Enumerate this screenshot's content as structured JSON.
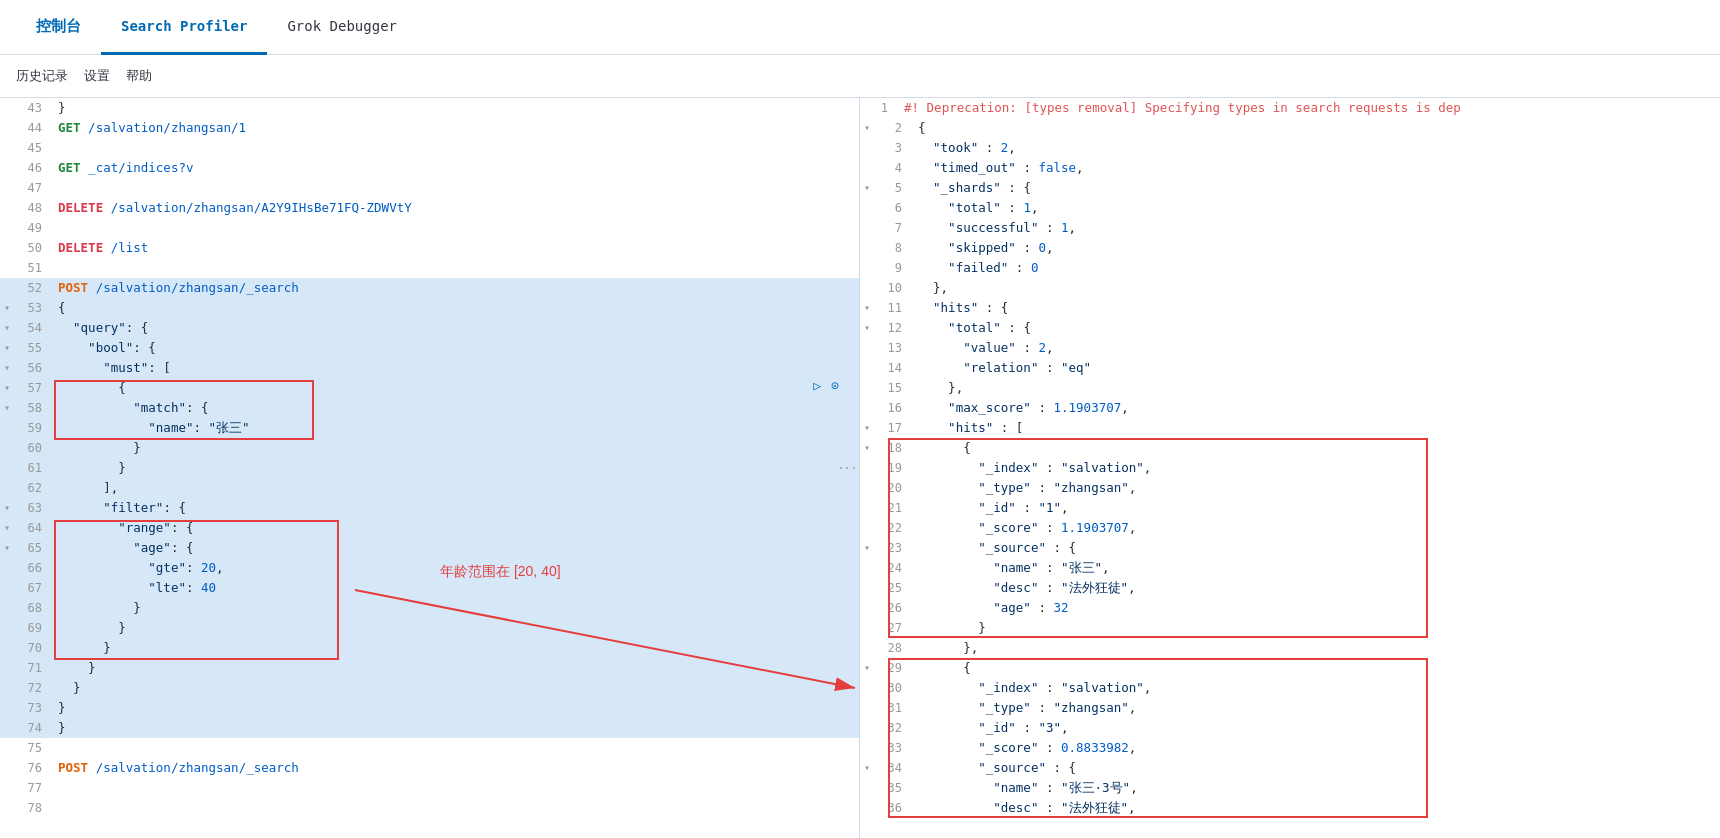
{
  "nav": {
    "items": [
      {
        "label": "控制台",
        "active": false,
        "chinese": true
      },
      {
        "label": "Search Profiler",
        "active": true
      },
      {
        "label": "Grok Debugger",
        "active": false
      }
    ]
  },
  "toolbar": {
    "items": [
      "历史记录",
      "设置",
      "帮助"
    ]
  },
  "editor": {
    "lines": [
      {
        "num": "43",
        "content": "}"
      },
      {
        "num": "44",
        "content": "GET /salvation/zhangsan/1",
        "type": "get"
      },
      {
        "num": "45",
        "content": ""
      },
      {
        "num": "46",
        "content": "GET _cat/indices?v",
        "type": "get"
      },
      {
        "num": "47",
        "content": ""
      },
      {
        "num": "48",
        "content": "DELETE /salvation/zhangsan/A2Y9IHsBe71FQ-ZDWVtY",
        "type": "delete"
      },
      {
        "num": "49",
        "content": ""
      },
      {
        "num": "50",
        "content": "DELETE /list",
        "type": "delete"
      },
      {
        "num": "51",
        "content": ""
      },
      {
        "num": "52",
        "content": "POST /salvation/zhangsan/_search",
        "type": "post",
        "selected": true
      },
      {
        "num": "53",
        "content": "{",
        "selected": true
      },
      {
        "num": "54",
        "content": "  \"query\": {",
        "selected": true
      },
      {
        "num": "55",
        "content": "    \"bool\": {",
        "selected": true
      },
      {
        "num": "56",
        "content": "      \"must\": [",
        "selected": true
      },
      {
        "num": "57",
        "content": "        {",
        "selected": true
      },
      {
        "num": "58",
        "content": "          \"match\": {",
        "selected": true,
        "boxed": "match_open"
      },
      {
        "num": "59",
        "content": "            \"name\": \"张三\"",
        "selected": true,
        "boxed": "match_inner"
      },
      {
        "num": "60",
        "content": "          }",
        "selected": true,
        "boxed": "match_close"
      },
      {
        "num": "61",
        "content": "        }",
        "selected": true
      },
      {
        "num": "62",
        "content": "      ],",
        "selected": true
      },
      {
        "num": "63",
        "content": "      \"filter\": {",
        "selected": true,
        "boxed": "filter_open"
      },
      {
        "num": "64",
        "content": "        \"range\": {",
        "selected": true,
        "boxed": "filter_inner"
      },
      {
        "num": "65",
        "content": "          \"age\": {",
        "selected": true,
        "boxed": "filter_inner"
      },
      {
        "num": "66",
        "content": "            \"gte\": 20,",
        "selected": true,
        "boxed": "filter_inner"
      },
      {
        "num": "67",
        "content": "            \"lte\": 40",
        "selected": true,
        "boxed": "filter_inner"
      },
      {
        "num": "68",
        "content": "          }",
        "selected": true,
        "boxed": "filter_inner"
      },
      {
        "num": "69",
        "content": "        }",
        "selected": true,
        "boxed": "filter_close"
      },
      {
        "num": "70",
        "content": "      }",
        "selected": true
      },
      {
        "num": "71",
        "content": "    }",
        "selected": true
      },
      {
        "num": "72",
        "content": "  }",
        "selected": true
      },
      {
        "num": "73",
        "content": "}",
        "selected": true
      },
      {
        "num": "74",
        "content": "}",
        "selected": true
      },
      {
        "num": "75",
        "content": ""
      },
      {
        "num": "76",
        "content": "POST /salvation/zhangsan/_search",
        "type": "post"
      },
      {
        "num": "77",
        "content": ""
      },
      {
        "num": "78",
        "content": ""
      }
    ]
  },
  "output": {
    "lines": [
      {
        "num": "1",
        "content": "#! Deprecation: [types removal] Specifying types in search requests is dep",
        "type": "comment"
      },
      {
        "num": "2",
        "content": "{"
      },
      {
        "num": "3",
        "content": "  \"took\" : 2,"
      },
      {
        "num": "4",
        "content": "  \"timed_out\" : false,"
      },
      {
        "num": "5",
        "content": "  \"_shards\" : {"
      },
      {
        "num": "6",
        "content": "    \"total\" : 1,"
      },
      {
        "num": "7",
        "content": "    \"successful\" : 1,"
      },
      {
        "num": "8",
        "content": "    \"skipped\" : 0,"
      },
      {
        "num": "9",
        "content": "    \"failed\" : 0"
      },
      {
        "num": "10",
        "content": "  },"
      },
      {
        "num": "11",
        "content": "  \"hits\" : {"
      },
      {
        "num": "12",
        "content": "    \"total\" : {"
      },
      {
        "num": "13",
        "content": "      \"value\" : 2,"
      },
      {
        "num": "14",
        "content": "      \"relation\" : \"eq\""
      },
      {
        "num": "15",
        "content": "    },"
      },
      {
        "num": "16",
        "content": "    \"max_score\" : 1.1903707,"
      },
      {
        "num": "17",
        "content": "    \"hits\" : ["
      },
      {
        "num": "18",
        "content": "      {",
        "boxed": "hit1_open"
      },
      {
        "num": "19",
        "content": "        \"_index\" : \"salvation\",",
        "boxed": "hit1"
      },
      {
        "num": "20",
        "content": "        \"_type\" : \"zhangsan\",",
        "boxed": "hit1"
      },
      {
        "num": "21",
        "content": "        \"_id\" : \"1\",",
        "boxed": "hit1"
      },
      {
        "num": "22",
        "content": "        \"_score\" : 1.1903707,",
        "boxed": "hit1"
      },
      {
        "num": "23",
        "content": "        \"_source\" : {",
        "boxed": "hit1"
      },
      {
        "num": "24",
        "content": "          \"name\" : \"张三\",",
        "boxed": "hit1"
      },
      {
        "num": "25",
        "content": "          \"desc\" : \"法外狂徒\",",
        "boxed": "hit1"
      },
      {
        "num": "26",
        "content": "          \"age\" : 32",
        "boxed": "hit1"
      },
      {
        "num": "27",
        "content": "        }",
        "boxed": "hit1_close"
      },
      {
        "num": "28",
        "content": "      },"
      },
      {
        "num": "29",
        "content": "      {",
        "boxed": "hit2_open"
      },
      {
        "num": "30",
        "content": "        \"_index\" : \"salvation\",",
        "boxed": "hit2"
      },
      {
        "num": "31",
        "content": "        \"_type\" : \"zhangsan\",",
        "boxed": "hit2"
      },
      {
        "num": "32",
        "content": "        \"_id\" : \"3\",",
        "boxed": "hit2"
      },
      {
        "num": "33",
        "content": "        \"_score\" : 0.8833982,",
        "boxed": "hit2"
      },
      {
        "num": "34",
        "content": "        \"_source\" : {",
        "boxed": "hit2"
      },
      {
        "num": "35",
        "content": "          \"name\" : \"张三·3号\",",
        "boxed": "hit2"
      },
      {
        "num": "36",
        "content": "          \"desc\" : \"法外狂徒\",",
        "boxed": "hit2"
      }
    ]
  },
  "annotation": {
    "label": "年龄范围在 [20, 40]"
  }
}
